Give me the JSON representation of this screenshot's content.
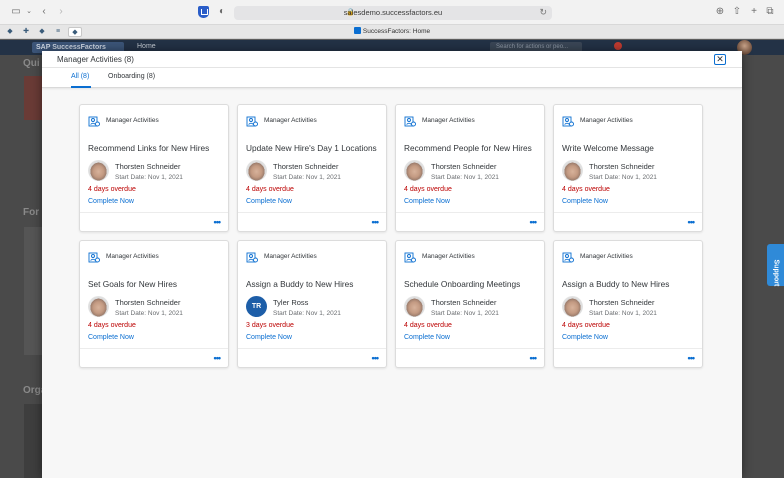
{
  "browser": {
    "url": "salesdemo.successfactors.eu",
    "tab_title": "SuccessFactors: Home"
  },
  "background": {
    "logo": "SAP SuccessFactors",
    "home": "Home",
    "search_placeholder": "Search for actions or peo...",
    "notif_count": "25",
    "quick_heading": "Qui",
    "for_heading": "For",
    "org_heading": "Orga",
    "support": "Support"
  },
  "dialog": {
    "title": "Manager Activities (8)",
    "close": "✕",
    "tabs": [
      {
        "label": "All (8)",
        "active": true
      },
      {
        "label": "Onboarding (8)",
        "active": false
      }
    ],
    "more_icon": "•••",
    "cards": [
      {
        "type": "Manager Activities",
        "title": "Recommend Links for New Hires",
        "person": "Thorsten Schneider",
        "avatar": "photo",
        "initials": "",
        "start": "Start Date: Nov 1, 2021",
        "status": "4 days overdue",
        "action": "Complete Now"
      },
      {
        "type": "Manager Activities",
        "title": "Update New Hire's Day 1 Locations",
        "person": "Thorsten Schneider",
        "avatar": "photo",
        "initials": "",
        "start": "Start Date: Nov 1, 2021",
        "status": "4 days overdue",
        "action": "Complete Now"
      },
      {
        "type": "Manager Activities",
        "title": "Recommend People for New Hires",
        "person": "Thorsten Schneider",
        "avatar": "photo",
        "initials": "",
        "start": "Start Date: Nov 1, 2021",
        "status": "4 days overdue",
        "action": "Complete Now"
      },
      {
        "type": "Manager Activities",
        "title": "Write Welcome Message",
        "person": "Thorsten Schneider",
        "avatar": "photo",
        "initials": "",
        "start": "Start Date: Nov 1, 2021",
        "status": "4 days overdue",
        "action": "Complete Now"
      },
      {
        "type": "Manager Activities",
        "title": "Set Goals for New Hires",
        "person": "Thorsten Schneider",
        "avatar": "photo",
        "initials": "",
        "start": "Start Date: Nov 1, 2021",
        "status": "4 days overdue",
        "action": "Complete Now"
      },
      {
        "type": "Manager Activities",
        "title": "Assign a Buddy to New Hires",
        "person": "Tyler Ross",
        "avatar": "initials",
        "initials": "TR",
        "start": "Start Date: Nov 1, 2021",
        "status": "3 days overdue",
        "action": "Complete Now"
      },
      {
        "type": "Manager Activities",
        "title": "Schedule Onboarding Meetings",
        "person": "Thorsten Schneider",
        "avatar": "photo",
        "initials": "",
        "start": "Start Date: Nov 1, 2021",
        "status": "4 days overdue",
        "action": "Complete Now"
      },
      {
        "type": "Manager Activities",
        "title": "Assign a Buddy to New Hires",
        "person": "Thorsten Schneider",
        "avatar": "photo",
        "initials": "",
        "start": "Start Date: Nov 1, 2021",
        "status": "4 days overdue",
        "action": "Complete Now"
      }
    ]
  },
  "colors": {
    "accent": "#0a6ed1",
    "overdue": "#bb0000",
    "initials_bg": "#1d5ea8"
  }
}
